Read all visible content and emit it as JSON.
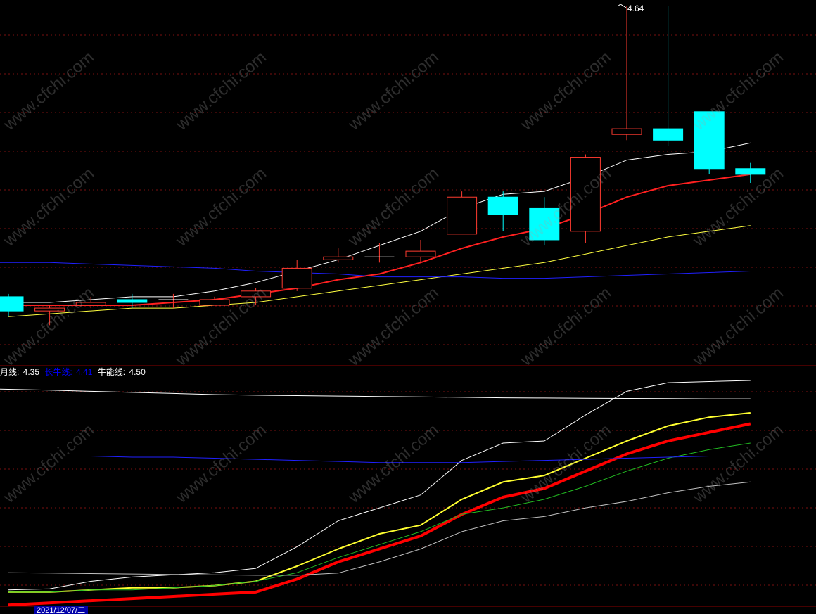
{
  "watermark": "www.cfchi.com",
  "colors": {
    "background": "#000000",
    "up": "#ff3b30",
    "down": "#00ffff",
    "separator": "#8b0000",
    "grid": "#7a1010"
  },
  "legend": [
    {
      "label": "月线: ",
      "value": "4.35",
      "color": "#ffffff"
    },
    {
      "label": "长牛线: ",
      "value": "4.41",
      "color": "#0000ff"
    },
    {
      "label": "牛能线: ",
      "value": "4.50",
      "color": "#ffffff"
    }
  ],
  "date_label": "2021/12/07/二",
  "peak_label": "4.64",
  "chart_data": [
    {
      "type": "candlestick",
      "panel": "price",
      "title": "",
      "ylim": [
        3.4,
        4.66
      ],
      "candles": [
        {
          "open": 3.63,
          "close": 3.58,
          "high": 3.64,
          "low": 3.56
        },
        {
          "open": 3.58,
          "close": 3.59,
          "high": 3.6,
          "low": 3.53
        },
        {
          "open": 3.6,
          "close": 3.61,
          "high": 3.63,
          "low": 3.59
        },
        {
          "open": 3.62,
          "close": 3.61,
          "high": 3.64,
          "low": 3.59
        },
        {
          "open": 3.62,
          "close": 3.62,
          "high": 3.64,
          "low": 3.59
        },
        {
          "open": 3.6,
          "close": 3.62,
          "high": 3.63,
          "low": 3.6
        },
        {
          "open": 3.63,
          "close": 3.65,
          "high": 3.66,
          "low": 3.6
        },
        {
          "open": 3.66,
          "close": 3.73,
          "high": 3.76,
          "low": 3.65
        },
        {
          "open": 3.76,
          "close": 3.77,
          "high": 3.8,
          "low": 3.75
        },
        {
          "open": 3.77,
          "close": 3.77,
          "high": 3.82,
          "low": 3.75
        },
        {
          "open": 3.77,
          "close": 3.79,
          "high": 3.83,
          "low": 3.75
        },
        {
          "open": 3.85,
          "close": 3.98,
          "high": 4.0,
          "low": 3.85
        },
        {
          "open": 3.98,
          "close": 3.92,
          "high": 4.0,
          "low": 3.86
        },
        {
          "open": 3.94,
          "close": 3.83,
          "high": 3.98,
          "low": 3.81
        },
        {
          "open": 3.86,
          "close": 4.12,
          "high": 4.13,
          "low": 3.82
        },
        {
          "open": 4.2,
          "close": 4.22,
          "high": 4.65,
          "low": 4.18
        },
        {
          "open": 4.22,
          "close": 4.18,
          "high": 4.65,
          "low": 4.16
        },
        {
          "open": 4.28,
          "close": 4.08,
          "high": 4.28,
          "low": 4.06
        },
        {
          "open": 4.08,
          "close": 4.06,
          "high": 4.1,
          "low": 4.03
        }
      ],
      "series": [
        {
          "color": "#ffffff",
          "width": 1,
          "values": [
            3.61,
            3.61,
            3.62,
            3.63,
            3.63,
            3.65,
            3.68,
            3.72,
            3.76,
            3.81,
            3.86,
            3.94,
            3.99,
            4.0,
            4.05,
            4.11,
            4.13,
            4.14,
            4.17
          ]
        },
        {
          "color": "#ff2020",
          "width": 2,
          "values": [
            3.6,
            3.6,
            3.6,
            3.6,
            3.61,
            3.62,
            3.64,
            3.66,
            3.69,
            3.71,
            3.75,
            3.8,
            3.84,
            3.87,
            3.92,
            3.98,
            4.02,
            4.04,
            4.06
          ]
        },
        {
          "color": "#ffff40",
          "width": 1,
          "values": [
            3.56,
            3.57,
            3.58,
            3.59,
            3.59,
            3.6,
            3.61,
            3.63,
            3.65,
            3.67,
            3.69,
            3.71,
            3.73,
            3.75,
            3.78,
            3.81,
            3.84,
            3.86,
            3.88
          ]
        },
        {
          "color": "#2020ff",
          "width": 1,
          "values": [
            3.75,
            3.75,
            3.745,
            3.74,
            3.735,
            3.73,
            3.72,
            3.715,
            3.71,
            3.7,
            3.7,
            3.7,
            3.695,
            3.695,
            3.7,
            3.705,
            3.71,
            3.715,
            3.72
          ],
          "x_start": -1
        }
      ]
    },
    {
      "type": "line",
      "panel": "indicator",
      "title": "",
      "ylim": [
        0,
        100
      ],
      "series": [
        {
          "color": "#ffffff",
          "width": 1,
          "values": [
            96,
            95.5,
            95,
            94.5,
            94,
            93.5,
            93.2,
            93,
            92.8,
            92.6,
            92.4,
            92.2,
            92.0,
            91.9,
            91.8,
            91.7,
            91.6,
            91.5,
            91.5
          ],
          "x_start": -1
        },
        {
          "color": "#ffffff",
          "width": 1,
          "values": [
            3,
            3.5,
            7,
            9,
            10,
            11,
            13,
            23,
            35,
            41,
            47,
            63,
            71,
            72,
            84,
            95,
            99,
            99.5,
            100
          ]
        },
        {
          "color": "#ffff30",
          "width": 2,
          "values": [
            2,
            2,
            3,
            4,
            4,
            5,
            7,
            14,
            22,
            29,
            33,
            45,
            53,
            56,
            64,
            72,
            79,
            83,
            85
          ]
        },
        {
          "color": "#ff0000",
          "width": 4,
          "values": [
            -4,
            -3,
            -2,
            -1,
            0,
            1,
            2,
            8,
            16,
            22,
            28,
            38,
            46,
            50,
            58,
            66,
            72,
            76,
            80
          ]
        },
        {
          "color": "#22bb22",
          "width": 1,
          "values": [
            2,
            2,
            3,
            3,
            4,
            5,
            7,
            11,
            18,
            24,
            30,
            38,
            41,
            45,
            51,
            58,
            64,
            68,
            71
          ]
        },
        {
          "color": "#c0c0c0",
          "width": 1,
          "values": [
            11,
            10.8,
            10.6,
            10.4,
            10.2,
            10.0,
            9.8,
            9.8,
            10.8,
            16,
            22,
            30,
            35,
            37,
            41,
            44,
            48,
            51,
            53
          ]
        },
        {
          "color": "#2020ff",
          "width": 1,
          "values": [
            65,
            65,
            65,
            64.5,
            64.5,
            64,
            63.5,
            63,
            62.5,
            62,
            62,
            62,
            62.5,
            63,
            63.5,
            64,
            64.5,
            65,
            65
          ],
          "x_start": -1
        }
      ]
    }
  ]
}
